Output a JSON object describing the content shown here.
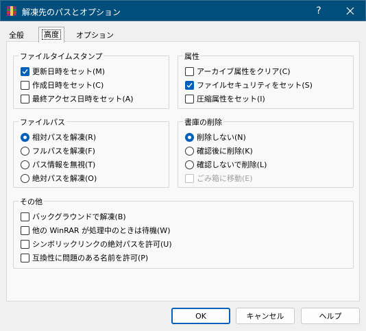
{
  "window": {
    "title": "解凍先のパスとオプション",
    "help_label": "?",
    "icon": "winrar-icon"
  },
  "tabs": [
    {
      "label": "全般",
      "active": false
    },
    {
      "label": "高度",
      "active": true
    },
    {
      "label": "オプション",
      "active": false
    }
  ],
  "groups": {
    "file_time": {
      "title": "ファイルタイムスタンプ",
      "items": [
        {
          "label": "更新日時をセット(M)",
          "checked": true
        },
        {
          "label": "作成日時をセット(C)",
          "checked": false
        },
        {
          "label": "最終アクセス日時をセット(A)",
          "checked": false
        }
      ]
    },
    "attributes": {
      "title": "属性",
      "items": [
        {
          "label": "アーカイブ属性をクリア(C)",
          "checked": false
        },
        {
          "label": "ファイルセキュリティをセット(S)",
          "checked": true
        },
        {
          "label": "圧縮属性をセット(I)",
          "checked": false
        }
      ]
    },
    "file_path": {
      "title": "ファイルパス",
      "items": [
        {
          "label": "相対パスを解凍(R)",
          "selected": true
        },
        {
          "label": "フルパスを解凍(F)",
          "selected": false
        },
        {
          "label": "パス情報を無視(T)",
          "selected": false
        },
        {
          "label": "絶対パスを解凍(O)",
          "selected": false
        }
      ]
    },
    "delete_archive": {
      "title": "書庫の削除",
      "items": [
        {
          "label": "削除しない(N)",
          "selected": true
        },
        {
          "label": "確認後に削除(K)",
          "selected": false
        },
        {
          "label": "確認しないで削除(L)",
          "selected": false
        }
      ],
      "recycle": {
        "label": "ごみ箱に移動(E)",
        "checked": false,
        "disabled": true
      }
    },
    "misc": {
      "title": "その他",
      "items": [
        {
          "label": "バックグラウンドで解凍(B)",
          "checked": false
        },
        {
          "label": "他の WinRAR が処理中のときは待機(W)",
          "checked": false
        },
        {
          "label": "シンボリックリンクの絶対パスを許可(U)",
          "checked": false
        },
        {
          "label": "互換性に問題のある名前を許可(P)",
          "checked": false
        }
      ]
    }
  },
  "buttons": {
    "ok": "OK",
    "cancel": "キャンセル",
    "help": "ヘルプ"
  },
  "colors": {
    "titlebar": "#004e7c",
    "accent": "#005fb8"
  }
}
